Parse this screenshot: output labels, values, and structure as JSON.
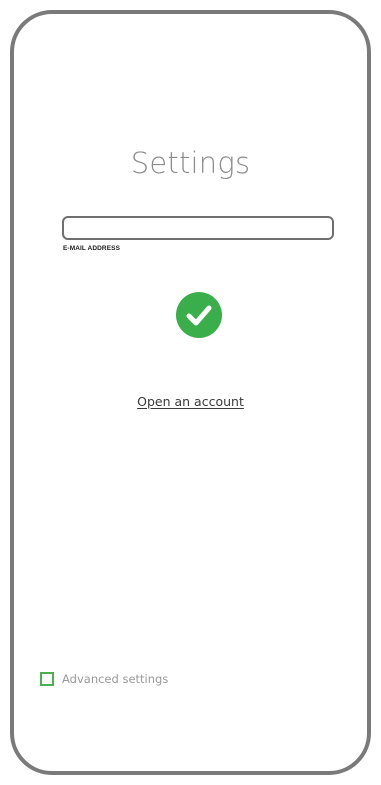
{
  "page": {
    "title": "Settings"
  },
  "email": {
    "value": "",
    "placeholder": "",
    "label": "E-MAIL ADDRESS"
  },
  "status": {
    "icon": "check-circle-icon",
    "color": "#3aae4b"
  },
  "links": {
    "open_account": "Open an account"
  },
  "advanced": {
    "label": "Advanced settings",
    "checked": false,
    "checkbox_color": "#4caf50"
  },
  "frame": {
    "border_color": "#7a7a7a"
  }
}
